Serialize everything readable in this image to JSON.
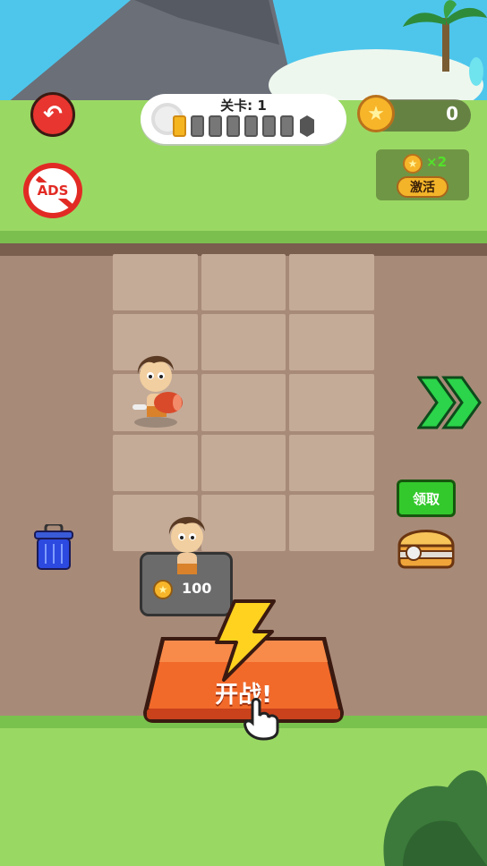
{
  "level": {
    "label": "关卡: 1",
    "current": 1,
    "total_segments": 8
  },
  "coins": {
    "count": "0",
    "icon": "star-coin-icon"
  },
  "boost": {
    "multiplier": "×2",
    "activate_label": "激活"
  },
  "chest": {
    "claim_label": "领取"
  },
  "buy": {
    "price": "100"
  },
  "start": {
    "label": "开战!"
  },
  "buttons": {
    "back_icon": "back-arrow-icon",
    "ads_label": "ADS"
  },
  "colors": {
    "sky": "#4ec6ec",
    "grass": "#9ad864",
    "dirt": "#a88a78",
    "start_orange": "#f26a2a",
    "accent_red": "#e8352f"
  }
}
